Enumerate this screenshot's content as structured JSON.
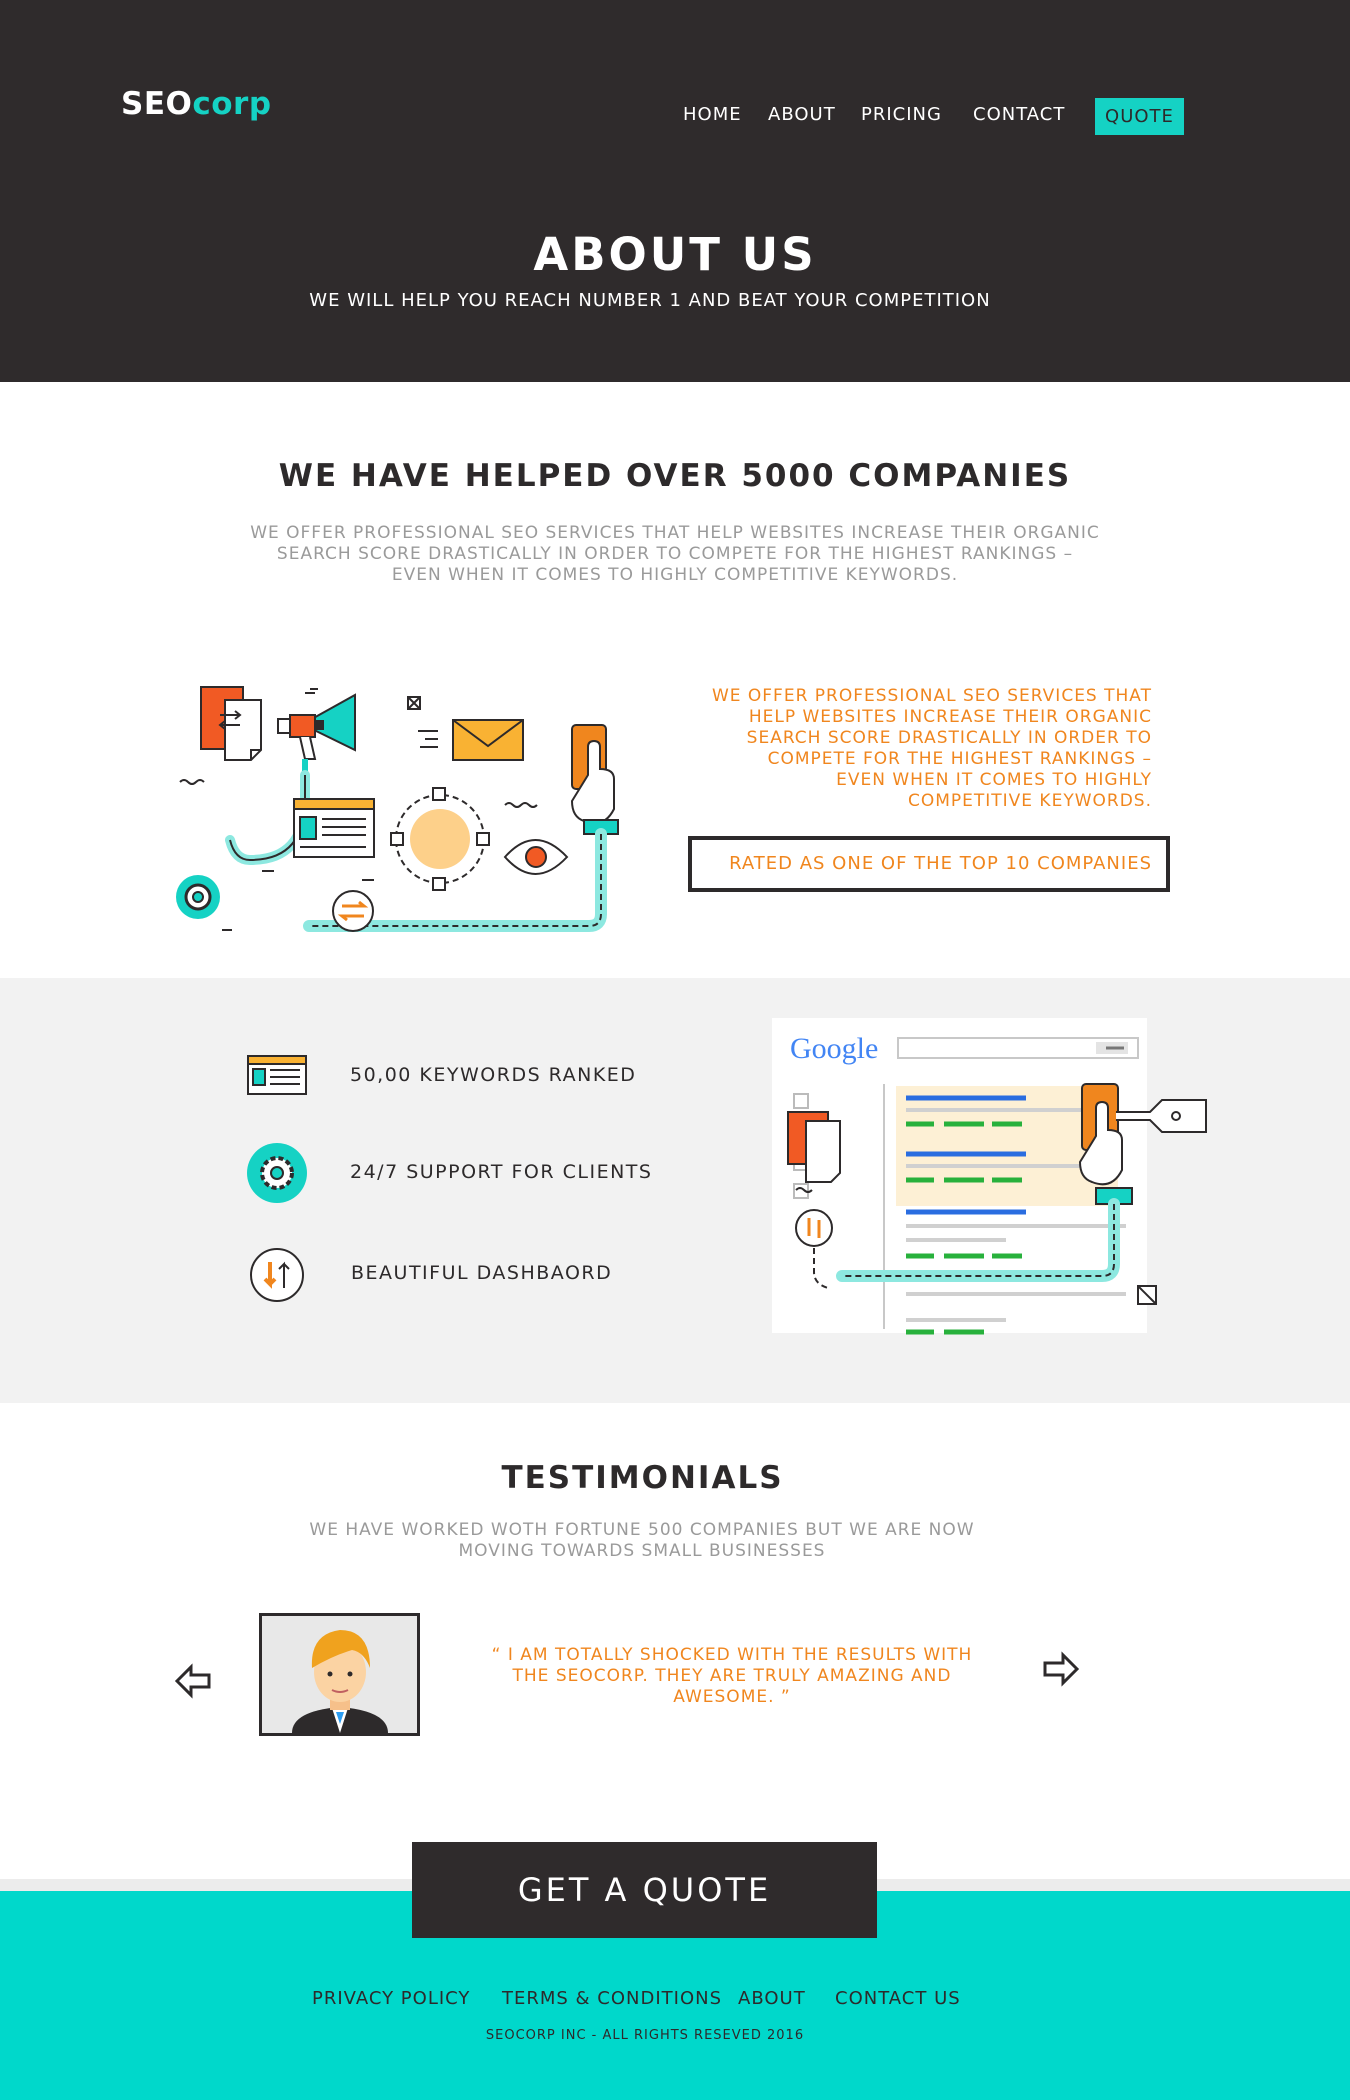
{
  "header": {
    "logo": {
      "part1": "SEO",
      "part2": "corp"
    },
    "nav": [
      "HOME",
      "ABOUT",
      "PRICING",
      "CONTACT"
    ],
    "quote_label": "QUOTE",
    "hero_title": "ABOUT US",
    "hero_subtitle": "WE WILL HELP YOU REACH NUMBER 1 AND BEAT YOUR COMPETITION"
  },
  "intro": {
    "title": "WE HAVE HELPED OVER 5000 COMPANIES",
    "text_lines": [
      "WE OFFER PROFESSIONAL SEO SERVICES THAT HELP WEBSITES INCREASE THEIR ORGANIC",
      "SEARCH SCORE DRASTICALLY IN ORDER TO COMPETE FOR THE HIGHEST RANKINGS –",
      "EVEN WHEN IT COMES TO HIGHLY COMPETITIVE KEYWORDS."
    ],
    "orange_lines": [
      "WE OFFER PROFESSIONAL SEO SERVICES THAT",
      "HELP WEBSITES INCREASE THEIR ORGANIC",
      "SEARCH SCORE DRASTICALLY IN ORDER TO",
      "COMPETE FOR THE HIGHEST RANKINGS –",
      "EVEN WHEN IT COMES TO HIGHLY",
      "COMPETITIVE KEYWORDS."
    ],
    "rated": "RATED  AS ONE OF THE TOP 10 COMPANIES"
  },
  "features": [
    {
      "label": "50,00 KEYWORDS RANKED",
      "icon": "browser-window-icon"
    },
    {
      "label": "24/7 SUPPORT FOR CLIENTS",
      "icon": "gear-icon"
    },
    {
      "label": "BEAUTIFUL DASHBAORD",
      "icon": "up-down-arrows-icon"
    }
  ],
  "google_logo": "Google",
  "testimonials": {
    "title": "TESTIMONIALS",
    "sub_lines": [
      "WE HAVE WORKED WOTH FORTUNE 500 COMPANIES BUT WE ARE NOW",
      "MOVING TOWARDS SMALL BUSINESSES"
    ],
    "quote_lines": [
      "“ I AM TOTALLY SHOCKED WITH THE RESULTS WITH",
      "THE SEOCORP. THEY ARE TRULY AMAZING AND",
      "AWESOME. ”"
    ]
  },
  "cta_label": "GET A QUOTE",
  "footer": {
    "links": [
      "PRIVACY POLICY",
      "TERMS & CONDITIONS",
      "ABOUT",
      "CONTACT US"
    ],
    "copyright": "SEOCORP INC -  ALL RIGHTS RESEVED 2016"
  },
  "colors": {
    "dark": "#2f2b2c",
    "teal": "#15d2c4",
    "footer_teal": "#00d8cb",
    "orange": "#f0861e",
    "grey_bg": "#f2f2f2"
  }
}
